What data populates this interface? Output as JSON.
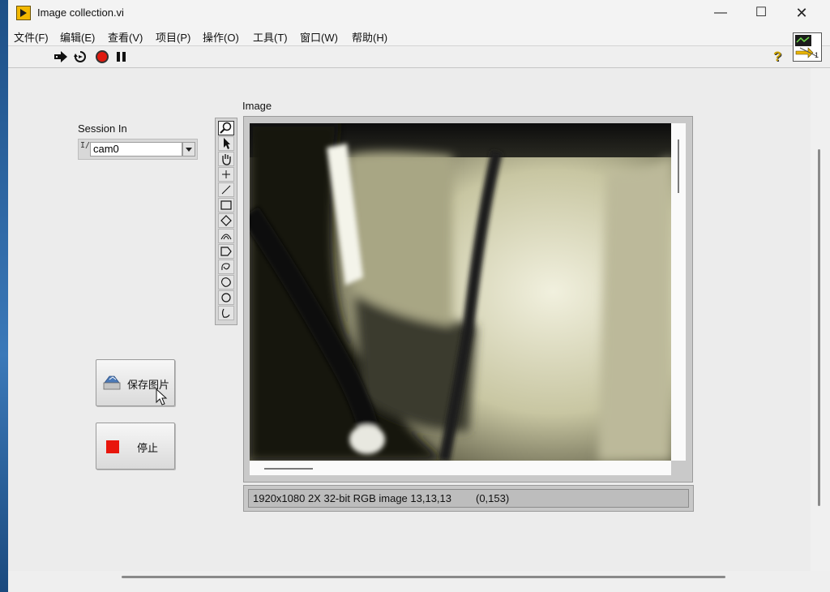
{
  "window": {
    "title": "Image collection.vi"
  },
  "menu": [
    "文件(F)",
    "编辑(E)",
    "查看(V)",
    "项目(P)",
    "操作(O)",
    "工具(T)",
    "窗口(W)",
    "帮助(H)"
  ],
  "toolbar": {
    "icons": [
      "run-arrow-icon",
      "run-continuously-icon",
      "abort-execution-icon",
      "pause-icon",
      "help-icon"
    ],
    "help_label": "?"
  },
  "vi_icon": {
    "badge": "1"
  },
  "session": {
    "label": "Session In",
    "io_glyph": "I/O",
    "value": "cam0"
  },
  "buttons": {
    "save_label": "保存图片",
    "stop_label": "停止"
  },
  "image": {
    "label": "Image",
    "status_info": "1920x1080 2X 32-bit RGB image 13,13,13",
    "status_coords": "(0,153)"
  },
  "palette_tools": [
    "zoom-tool",
    "select-tool",
    "pan-tool",
    "point-tool",
    "line-tool",
    "rectangle-tool",
    "rotated-rectangle-tool",
    "annulus-tool",
    "polygon-tool",
    "freehand-tool",
    "freehand-region-tool",
    "oval-tool",
    "broken-line-tool"
  ]
}
